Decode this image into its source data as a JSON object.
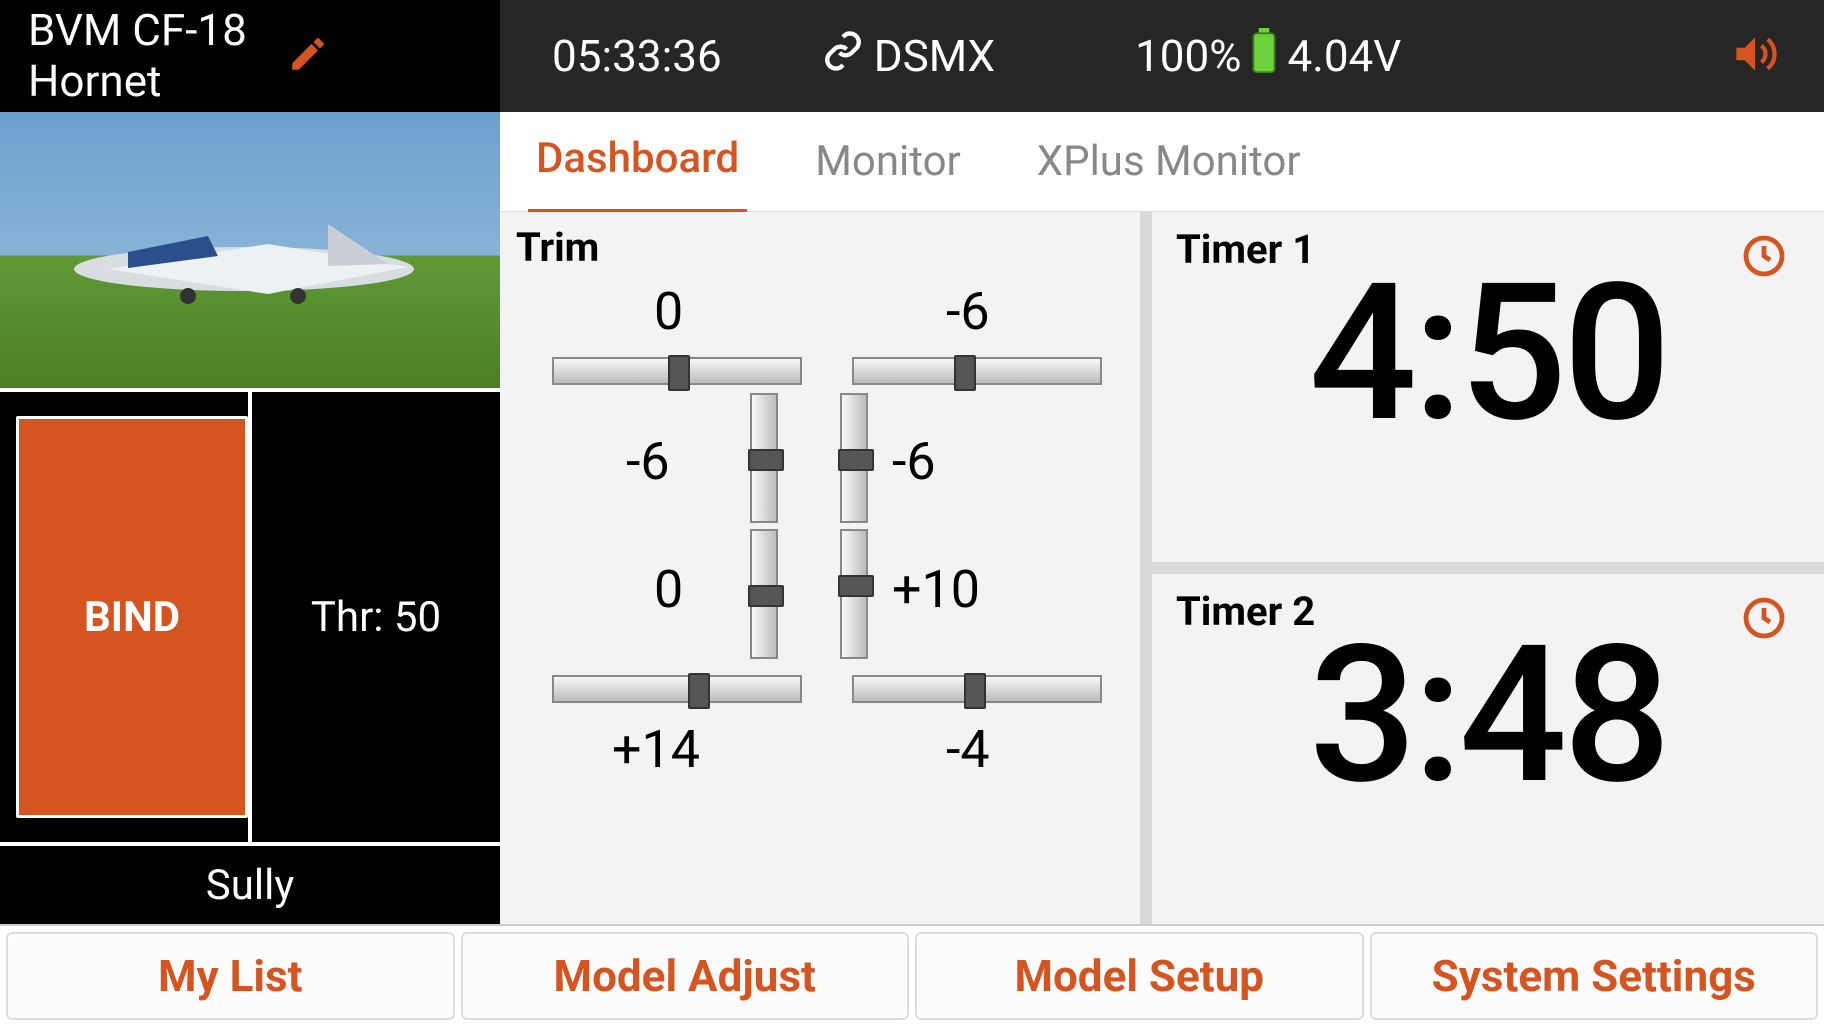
{
  "status": {
    "model_name": "BVM CF-18\nHornet",
    "time": "05:33:36",
    "link_type": "DSMX",
    "battery_pct": "100%",
    "voltage": "4.04V"
  },
  "sidebar": {
    "bind_label": "BIND",
    "throttle_label": "Thr: 50",
    "pilot_name": "Sully"
  },
  "tabs": [
    {
      "label": "Dashboard",
      "active": true
    },
    {
      "label": "Monitor",
      "active": false
    },
    {
      "label": "XPlus Monitor",
      "active": false
    }
  ],
  "trim": {
    "title": "Trim",
    "top_left": "0",
    "top_right": "-6",
    "mid_left": "-6",
    "mid_right": "-6",
    "low_left": "0",
    "low_right": "+10",
    "bottom_left": "+14",
    "bottom_right": "-4"
  },
  "timers": [
    {
      "label": "Timer 1",
      "value": "4:50"
    },
    {
      "label": "Timer 2",
      "value": "3:48"
    }
  ],
  "nav": {
    "mylist": "My List",
    "model_adjust": "Model Adjust",
    "model_setup": "Model Setup",
    "system_settings": "System Settings"
  }
}
